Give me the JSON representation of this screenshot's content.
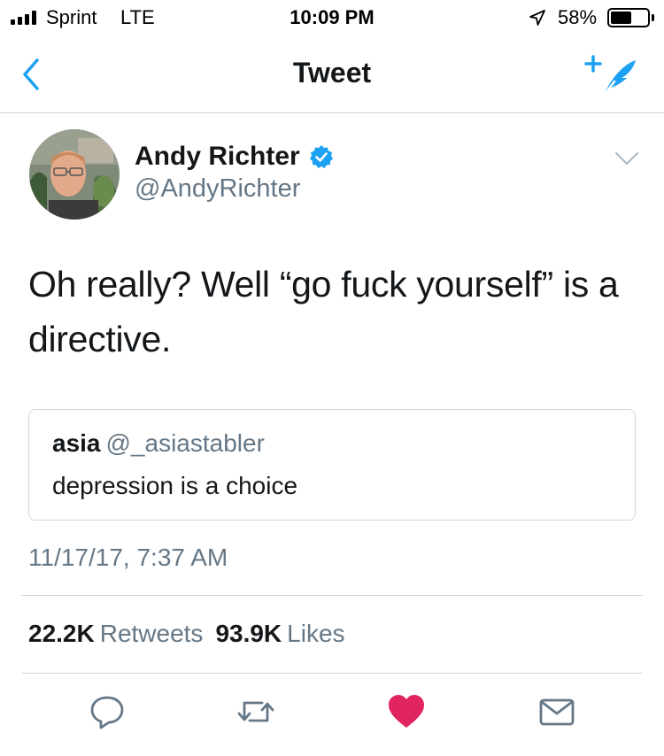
{
  "status_bar": {
    "carrier": "Sprint",
    "network": "LTE",
    "time": "10:09 PM",
    "battery_percent": "58%",
    "battery_level": 0.58,
    "signal_bars": 4,
    "location_icon": "location-arrow-icon"
  },
  "nav": {
    "title": "Tweet",
    "back_icon": "chevron-left-icon",
    "compose_icon": "compose-tweet-icon",
    "accent_color": "#1da1f2"
  },
  "tweet": {
    "author_name": "Andy Richter",
    "author_handle": "@AndyRichter",
    "verified": true,
    "text_line1": "Oh really?  Well “go fuck yourself” is a",
    "text_line2": "directive.",
    "quoted": {
      "name": "asia",
      "handle": "@_asiastabler",
      "text": "depression is a choice"
    },
    "timestamp": "11/17/17, 7:37 AM",
    "retweets_count": "22.2K",
    "retweets_label": "Retweets",
    "likes_count": "93.9K",
    "likes_label": "Likes",
    "liked": true,
    "like_color": "#e0245e"
  },
  "actions": [
    {
      "name": "reply",
      "icon": "reply-icon"
    },
    {
      "name": "retweet",
      "icon": "retweet-icon"
    },
    {
      "name": "like",
      "icon": "heart-icon"
    },
    {
      "name": "share",
      "icon": "envelope-icon"
    }
  ]
}
